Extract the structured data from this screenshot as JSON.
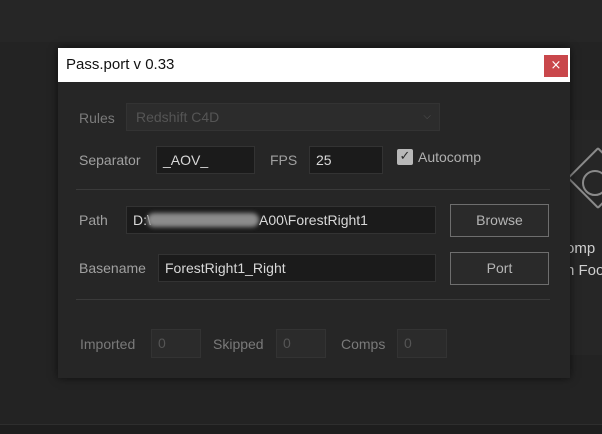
{
  "window": {
    "title": "Pass.port v 0.33",
    "close_glyph": "×"
  },
  "rules": {
    "label": "Rules",
    "value": "Redshift C4D"
  },
  "separator": {
    "label": "Separator",
    "value": "_AOV_"
  },
  "fps": {
    "label": "FPS",
    "value": "25"
  },
  "autocomp": {
    "label": "Autocomp",
    "checked": true,
    "check_glyph": "✓"
  },
  "path": {
    "label": "Path",
    "prefix": "D:\\",
    "suffix": "A00\\ForestRight1"
  },
  "basename": {
    "label": "Basename",
    "value": "ForestRight1_Right"
  },
  "buttons": {
    "browse": "Browse",
    "port": "Port"
  },
  "stats": {
    "imported_label": "Imported",
    "imported": "0",
    "skipped_label": "Skipped",
    "skipped": "0",
    "comps_label": "Comps",
    "comps": "0"
  },
  "background_panel": {
    "line1": "omp",
    "line2": "n Foo"
  },
  "colors": {
    "close_button": "#c9474b",
    "background": "#232323",
    "dialog": "#262626"
  }
}
